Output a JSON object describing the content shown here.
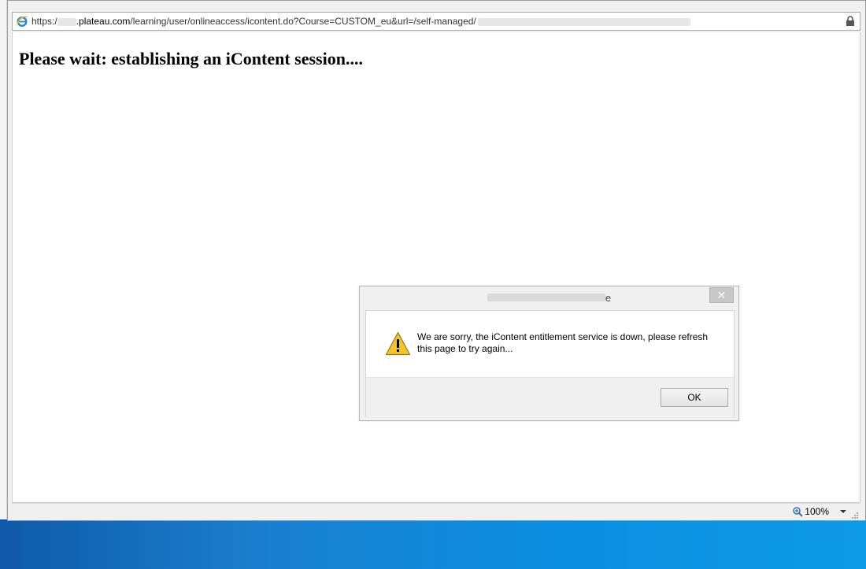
{
  "browser": {
    "url_prefix": "https:/",
    "url_domain": ".plateau.com",
    "url_path": "/learning/user/onlineaccess/icontent.do?Course=CUSTOM_eu&url=/self-managed/",
    "icon": "ie-icon",
    "lock_icon": "lock-icon"
  },
  "page": {
    "heading": "Please wait: establishing an iContent session...."
  },
  "dialog": {
    "title_visible_suffix": "e",
    "close_label": "✕",
    "message": "We are sorry, the iContent entitlement service is down, please refresh this page to try again...",
    "icon": "warning-icon",
    "ok_label": "OK"
  },
  "statusbar": {
    "zoom_level": "100%",
    "zoom_icon": "zoom-icon"
  },
  "colors": {
    "desktop_taskbar": "#0a8fe0",
    "close_button": "#c7c7c7"
  }
}
